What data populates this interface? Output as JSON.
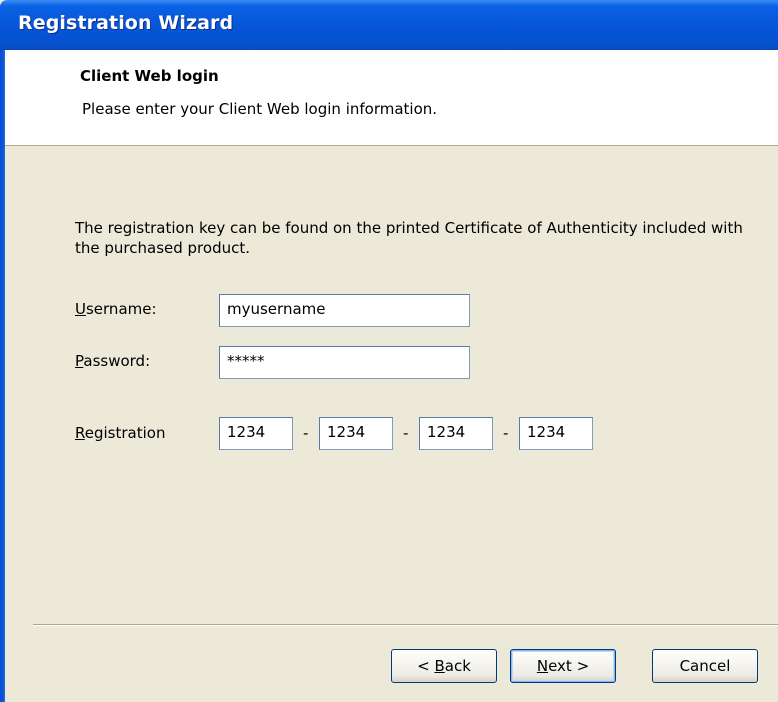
{
  "window": {
    "title": "Registration Wizard"
  },
  "header": {
    "title": "Client Web login",
    "subtitle": "Please enter your Client Web login information."
  },
  "intro": "The registration key can be found on the printed Certificate of Authenticity included with the purchased product.",
  "form": {
    "username": {
      "label_key": "U",
      "label_rest": "sername:",
      "value": "myusername"
    },
    "password": {
      "label_key": "P",
      "label_rest": "assword:",
      "value": "*****"
    },
    "registration": {
      "label_key": "R",
      "label_rest": "egistration",
      "parts": [
        "1234",
        "1234",
        "1234",
        "1234"
      ],
      "separator": "-"
    }
  },
  "buttons": {
    "back": {
      "arrow": "< ",
      "key": "B",
      "rest": "ack"
    },
    "next": {
      "key": "N",
      "rest": "ext",
      "arrow": " >"
    },
    "cancel": "Cancel"
  },
  "colors": {
    "titlebar": "#0756D8",
    "dialog_bg": "#ECE9D8",
    "header_bg": "#FFFFFF",
    "input_border": "#7F9DB9"
  }
}
